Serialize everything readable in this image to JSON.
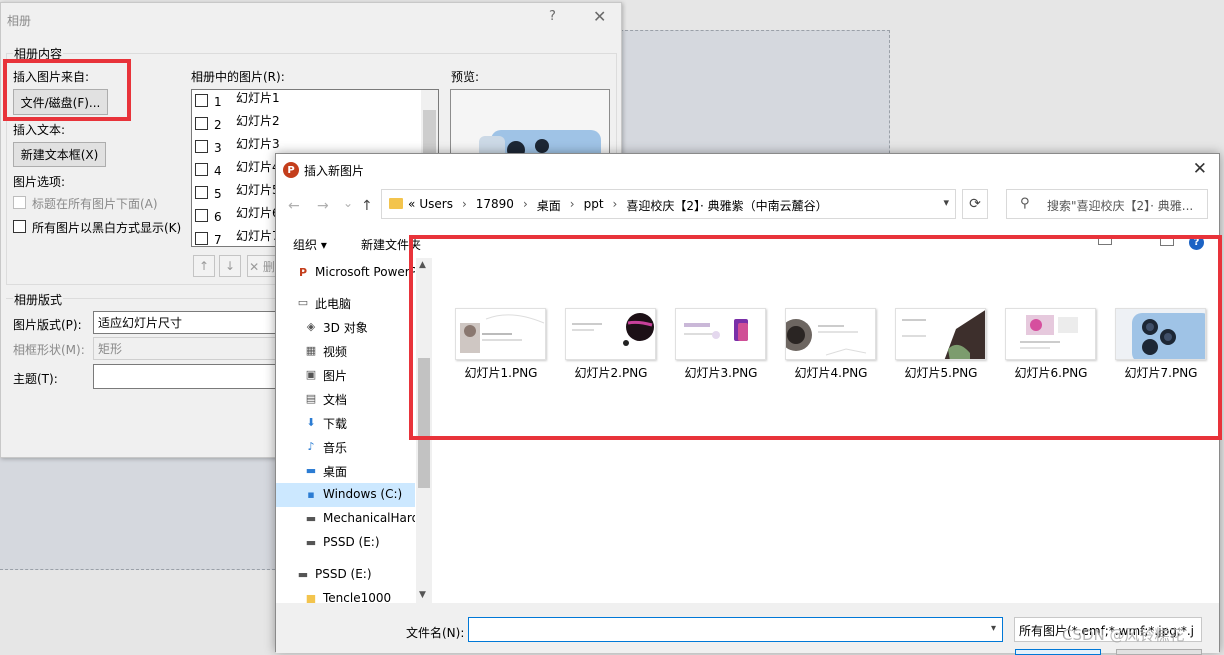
{
  "album_dialog": {
    "title": "相册",
    "help": "?",
    "close": "✕",
    "content_group": "相册内容",
    "insert_from_label": "插入图片来自:",
    "file_disk_button": "文件/磁盘(F)...",
    "insert_text_label": "插入文本:",
    "new_textbox_button": "新建文本框(X)",
    "picture_options_label": "图片选项:",
    "caption_option": "标题在所有图片下面(A)",
    "bw_option": "所有图片以黑白方式显示(K)",
    "list_label": "相册中的图片(R):",
    "pictures": [
      {
        "num": "1",
        "name": "幻灯片1"
      },
      {
        "num": "2",
        "name": "幻灯片2"
      },
      {
        "num": "3",
        "name": "幻灯片3"
      },
      {
        "num": "4",
        "name": "幻灯片4"
      },
      {
        "num": "5",
        "name": "幻灯片5"
      },
      {
        "num": "6",
        "name": "幻灯片6"
      },
      {
        "num": "7",
        "name": "幻灯片7"
      }
    ],
    "move_up": "↑",
    "move_down": "↓",
    "remove": "✕ 删",
    "preview_label": "预览:",
    "layout_group": "相册版式",
    "picture_layout_label": "图片版式(P):",
    "picture_layout_value": "适应幻灯片尺寸",
    "frame_shape_label": "相框形状(M):",
    "frame_shape_value": "矩形",
    "theme_label": "主题(T):",
    "theme_value": ""
  },
  "insert_dialog": {
    "title": "插入新图片",
    "close": "✕",
    "logo": "P",
    "nav": {
      "back": "←",
      "forward": "→",
      "recent": "⌄",
      "up": "↑"
    },
    "breadcrumb": [
      "«",
      "Users",
      "17890",
      "桌面",
      "ppt",
      "喜迎校庆【2】· 典雅紫（中南云麓谷）"
    ],
    "refresh": "⟳",
    "search_placeholder": "搜索\"喜迎校庆【2】· 典雅...",
    "organize": "组织 ▾",
    "new_folder": "新建文件夹",
    "help": "?",
    "sidebar": [
      {
        "icon": "ppt-icon",
        "glyph": "P",
        "label": "Microsoft PowerPoint",
        "indent": 1
      },
      {
        "icon": "computer-icon",
        "glyph": "▭",
        "label": "此电脑",
        "indent": 1
      },
      {
        "icon": "3d-objects-icon",
        "glyph": "◈",
        "label": "3D 对象",
        "indent": 2
      },
      {
        "icon": "video-icon",
        "glyph": "▦",
        "label": "视频",
        "indent": 2
      },
      {
        "icon": "pictures-icon",
        "glyph": "▣",
        "label": "图片",
        "indent": 2
      },
      {
        "icon": "documents-icon",
        "glyph": "▤",
        "label": "文档",
        "indent": 2
      },
      {
        "icon": "downloads-icon",
        "glyph": "⬇",
        "label": "下载",
        "indent": 2
      },
      {
        "icon": "music-icon",
        "glyph": "♪",
        "label": "音乐",
        "indent": 2
      },
      {
        "icon": "desktop-icon",
        "glyph": "▬",
        "label": "桌面",
        "indent": 2
      },
      {
        "icon": "windows-drive-icon",
        "glyph": "▪",
        "label": "Windows (C:)",
        "indent": 2
      },
      {
        "icon": "drive-icon",
        "glyph": "▬",
        "label": "MechanicalHard",
        "indent": 2
      },
      {
        "icon": "drive-icon",
        "glyph": "▬",
        "label": "PSSD (E:)",
        "indent": 2
      },
      {
        "icon": "drive-icon",
        "glyph": "▬",
        "label": "PSSD (E:)",
        "indent": 1
      },
      {
        "icon": "folder-icon",
        "glyph": "■",
        "label": "Tencle1000",
        "indent": 2
      }
    ],
    "files": [
      {
        "name": "幻灯片1.PNG"
      },
      {
        "name": "幻灯片2.PNG"
      },
      {
        "name": "幻灯片3.PNG"
      },
      {
        "name": "幻灯片4.PNG"
      },
      {
        "name": "幻灯片5.PNG"
      },
      {
        "name": "幻灯片6.PNG"
      },
      {
        "name": "幻灯片7.PNG"
      }
    ],
    "filename_label": "文件名(N):",
    "filename_value": "",
    "filter_value": "所有图片(*.emf;*.wmf;*.jpg;*.j"
  },
  "watermark": "CSDN @风铃糕花",
  "colors": {
    "highlight": "#e8333a",
    "accent": "#0078d7",
    "selected": "#cce8ff"
  }
}
